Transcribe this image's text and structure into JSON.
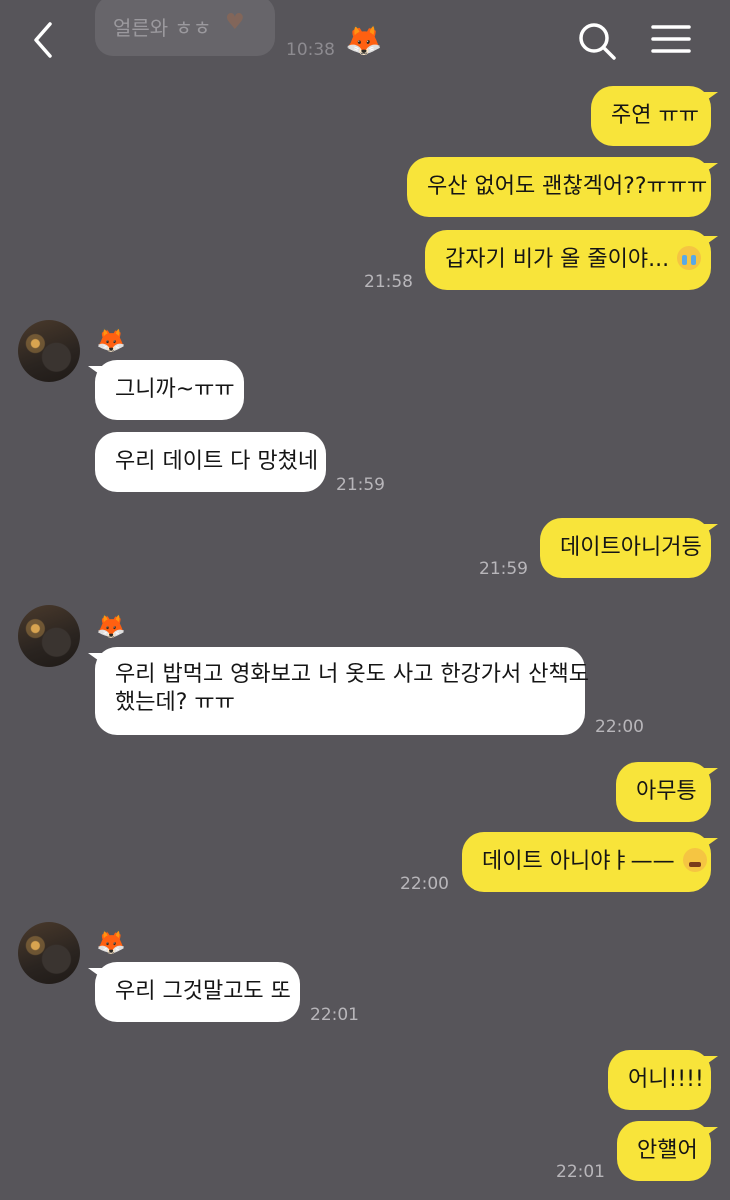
{
  "header": {
    "prev_bubble": "얼른와 ㅎㅎ",
    "prev_time": "10:38",
    "title_emoji": "🦊"
  },
  "messages": {
    "m1": "주연 ㅠㅠ",
    "m2": "우산 없어도 괜찮겍어??ㅠㅠㅠ",
    "m3": "갑자기 비가 올 줄이야...",
    "t1": "21:58",
    "sender_name": "🦊",
    "m4": "그니까~ㅠㅠ",
    "m5": "우리 데이트 다 망쳤네",
    "t2": "21:59",
    "m6": "데이트아니거등",
    "t3": "21:59",
    "m7_line1": "우리 밥먹고 영화보고 너 옷도 사고 한강가서 산책도",
    "m7_line2": "했는데? ㅠㅠ",
    "t4": "22:00",
    "m8": "아무틍",
    "m9": "데이트 아니야ㅑ——",
    "t5": "22:00",
    "m10": "우리 그것말고도 또",
    "t6": "22:01",
    "m11": "어니!!!!",
    "m12": "안햴어",
    "t7": "22:01"
  }
}
